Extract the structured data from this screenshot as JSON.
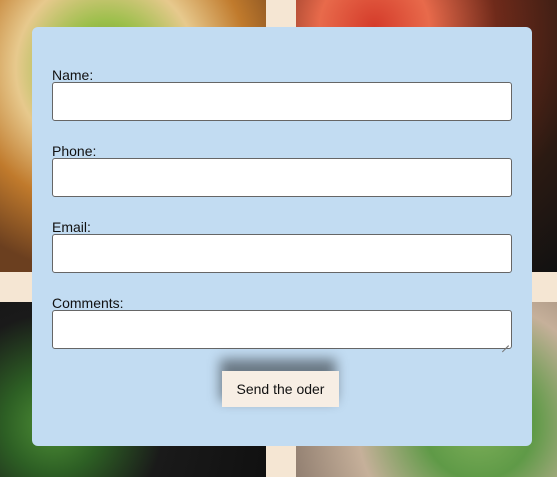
{
  "form": {
    "name_label": "Name:",
    "phone_label": "Phone:",
    "email_label": "Email:",
    "comments_label": "Comments:",
    "submit_label": "Send the oder"
  },
  "colors": {
    "card_bg": "#c2dcf2",
    "button_bg": "#f7eee4",
    "page_bg": "#f5e6d3"
  }
}
